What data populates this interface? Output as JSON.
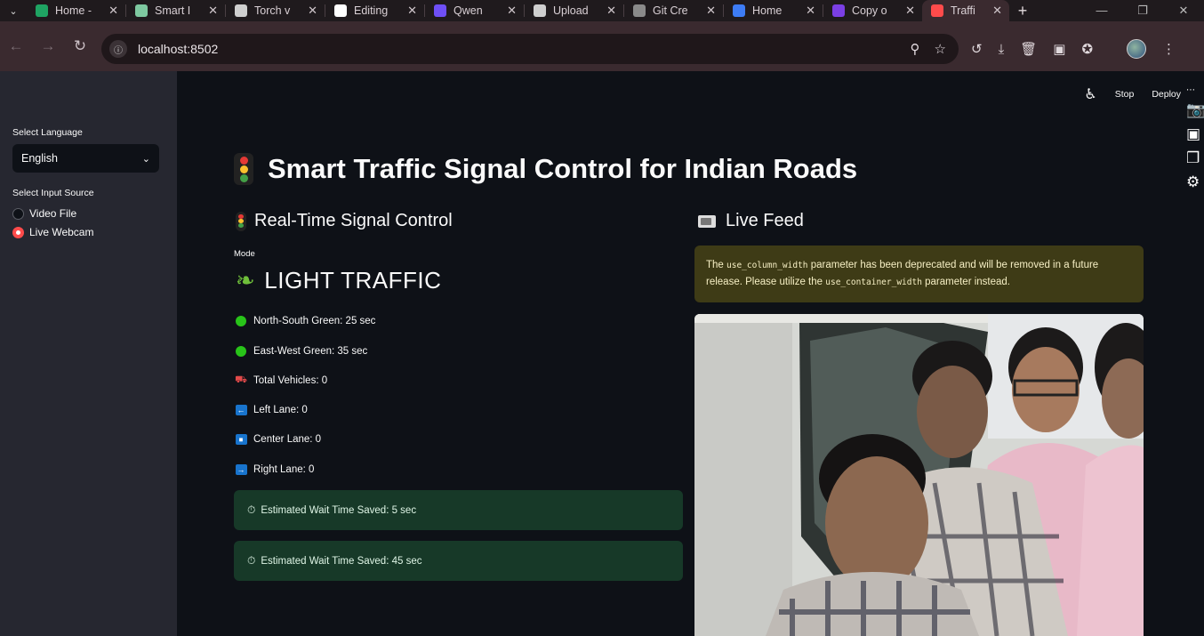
{
  "browser": {
    "tabs": [
      {
        "title": "Home -",
        "favicon_color": "#1fa463"
      },
      {
        "title": "Smart I",
        "favicon_color": "#7ec8a0"
      },
      {
        "title": "Torch v",
        "favicon_color": "#cfcfcf"
      },
      {
        "title": "Editing",
        "favicon_color": "#ffffff"
      },
      {
        "title": "Qwen",
        "favicon_color": "#6e4ff6"
      },
      {
        "title": "Upload",
        "favicon_color": "#cfcfcf"
      },
      {
        "title": "Git Cre",
        "favicon_color": "#8a8a8a"
      },
      {
        "title": "Home",
        "favicon_color": "#3d7cf5"
      },
      {
        "title": "Copy o",
        "favicon_color": "#7b3fe4"
      },
      {
        "title": "Traffi",
        "favicon_color": "#ff4b4b",
        "active": true
      }
    ],
    "url": "localhost:8502"
  },
  "sidebar": {
    "language_label": "Select Language",
    "language_value": "English",
    "input_label": "Select Input Source",
    "options": [
      {
        "label": "Video File",
        "selected": false
      },
      {
        "label": "Live Webcam",
        "selected": true
      }
    ]
  },
  "header": {
    "stop": "Stop",
    "deploy": "Deploy"
  },
  "page": {
    "title": "Smart Traffic Signal Control for Indian Roads",
    "left_heading": "Real-Time Signal Control",
    "right_heading": "Live Feed",
    "mode_label": "Mode",
    "mode_value": "LIGHT TRAFFIC",
    "stats": {
      "ns": "North-South Green: 25 sec",
      "ew": "East-West Green: 35 sec",
      "vehicles": "Total Vehicles: 0",
      "left": "Left Lane: 0",
      "center": "Center Lane: 0",
      "right": "Right Lane: 0"
    },
    "wait1": "Estimated Wait Time Saved: 5 sec",
    "wait2": "Estimated Wait Time Saved: 45 sec",
    "warning": {
      "p1": "The ",
      "code1": "use_column_width",
      "p2": " parameter has been deprecated and will be removed in a future release. Please utilize the ",
      "code2": "use_container_width",
      "p3": " parameter instead."
    }
  },
  "colors": {
    "accent": "#ff4b4b",
    "success_bg": "#173928",
    "warning_bg": "#3e3b16"
  }
}
